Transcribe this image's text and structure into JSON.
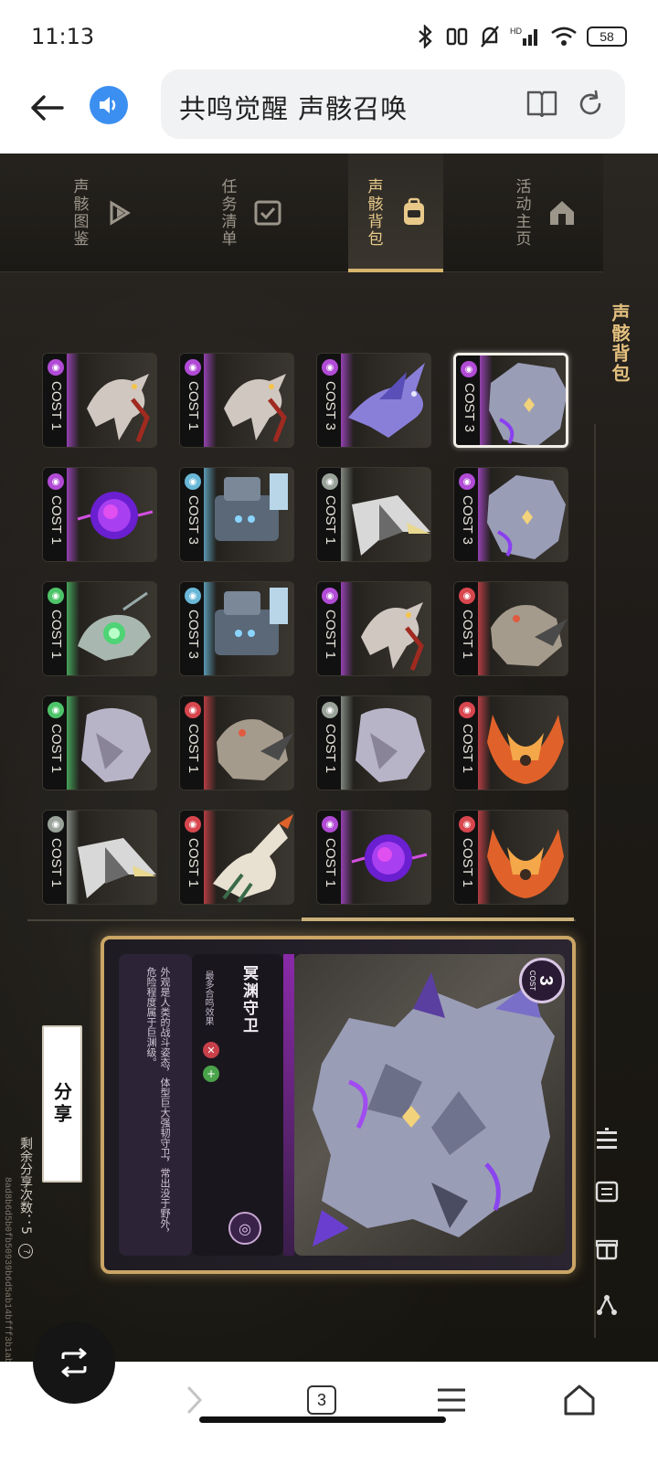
{
  "status": {
    "time": "11:13",
    "battery": "58"
  },
  "browser": {
    "page_title": "共鸣觉醒 声骸召唤",
    "tab_count": "3"
  },
  "nav": {
    "tabs": [
      {
        "label": "声骸图鉴",
        "icon": "catalog-icon",
        "active": false
      },
      {
        "label": "任务清单",
        "icon": "checklist-icon",
        "active": false
      },
      {
        "label": "声骸背包",
        "icon": "backpack-icon",
        "active": true
      },
      {
        "label": "活动主页",
        "icon": "home-icon",
        "active": false
      }
    ]
  },
  "panel_title": "声骸背包",
  "cards": [
    {
      "cost": "COST 1",
      "element": "havoc",
      "color": "#b14bd6",
      "art": "bird"
    },
    {
      "cost": "COST 1",
      "element": "havoc",
      "color": "#b14bd6",
      "art": "bird"
    },
    {
      "cost": "COST 3",
      "element": "havoc",
      "color": "#b14bd6",
      "art": "dragon"
    },
    {
      "cost": "COST 3",
      "element": "havoc",
      "color": "#b14bd6",
      "art": "beast",
      "selected": true
    },
    {
      "cost": "COST 1",
      "element": "havoc",
      "color": "#b14bd6",
      "art": "orb"
    },
    {
      "cost": "COST 3",
      "element": "glacio",
      "color": "#6ab8d8",
      "art": "golem"
    },
    {
      "cost": "COST 1",
      "element": "aero",
      "color": "#9aa39a",
      "art": "spike"
    },
    {
      "cost": "COST 3",
      "element": "havoc",
      "color": "#b14bd6",
      "art": "beast"
    },
    {
      "cost": "COST 1",
      "element": "aero",
      "color": "#4ec46a",
      "art": "frog"
    },
    {
      "cost": "COST 3",
      "element": "glacio",
      "color": "#6ab8d8",
      "art": "golem"
    },
    {
      "cost": "COST 1",
      "element": "havoc",
      "color": "#b14bd6",
      "art": "bird"
    },
    {
      "cost": "COST 1",
      "element": "fusion",
      "color": "#d8464e",
      "art": "hound"
    },
    {
      "cost": "COST 1",
      "element": "aero",
      "color": "#4ec46a",
      "art": "ghost"
    },
    {
      "cost": "COST 1",
      "element": "fusion",
      "color": "#d8464e",
      "art": "hound"
    },
    {
      "cost": "COST 1",
      "element": "aero",
      "color": "#9aa39a",
      "art": "ghost"
    },
    {
      "cost": "COST 1",
      "element": "fusion",
      "color": "#d8464e",
      "art": "flame"
    },
    {
      "cost": "COST 1",
      "element": "aero",
      "color": "#9aa39a",
      "art": "spike"
    },
    {
      "cost": "COST 1",
      "element": "fusion",
      "color": "#d8464e",
      "art": "wyvern"
    },
    {
      "cost": "COST 1",
      "element": "havoc",
      "color": "#b14bd6",
      "art": "orb"
    },
    {
      "cost": "COST 1",
      "element": "fusion",
      "color": "#d8464e",
      "art": "flame"
    }
  ],
  "detail": {
    "name": "冥渊守卫",
    "cost_number": "3",
    "cost_label": "COST",
    "subtitle": "最多合鸣效果",
    "description": "外观是人类的战斗姿态，体型巨大强韧守卫，常出没于野外，危险程度属于巨渊级。"
  },
  "share": {
    "button_label": "分享",
    "remaining_text": "剩余分享次数：5",
    "help": "?",
    "hash": "8ad8b6d5b0fb50939b6d5ab14bfff3b1ab"
  },
  "colors": {
    "gold": "#d7b56f",
    "havoc": "#b14bd6",
    "fusion": "#d8464e",
    "aero": "#4ec46a",
    "glacio": "#6ab8d8"
  }
}
